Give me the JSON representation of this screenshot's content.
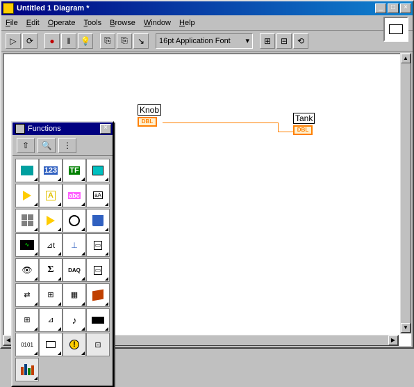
{
  "window": {
    "title": "Untitled 1 Diagram *",
    "minimize": "_",
    "maximize": "□",
    "close": "×"
  },
  "menu": {
    "file": "File",
    "edit": "Edit",
    "operate": "Operate",
    "tools": "Tools",
    "browse": "Browse",
    "window": "Window",
    "help": "Help"
  },
  "toolbar": {
    "run": "▷",
    "run_cont": "⟳",
    "abort": "●",
    "pause": "‖",
    "hilite": "💡",
    "retain": "⎘",
    "step": "⎘",
    "step_into": "↘",
    "font_label": "16pt Application Font",
    "align": "⊞",
    "dist": "⊟",
    "reorder": "⟲"
  },
  "palette": {
    "title": "Functions",
    "close": "×",
    "up": "⇧",
    "search": "🔍",
    "options": "⋮"
  },
  "diagram": {
    "knob": {
      "label": "Knob",
      "type": "DBL"
    },
    "tank": {
      "label": "Tank",
      "type": "DBL"
    }
  },
  "pal_items": {
    "struct": "▭",
    "num": "123",
    "bool": "TF",
    "arr": "",
    "tri": "▷",
    "str_a": "A",
    "str": "abc",
    "strbox": "aA",
    "clust": "",
    "comp": "",
    "timer": "",
    "disk": "",
    "wave": "∿",
    "axes": "⊿t",
    "stat": "⊥",
    "dev": "▭",
    "eye": "👁",
    "sigma": "Σ",
    "daq": "DAQ",
    "instr": "▭",
    "net": "⇄",
    "conn": "⊞",
    "vi": "▦",
    "cube": "",
    "app": "⊞",
    "math": "⊿",
    "note": "♪",
    "hat": "",
    "bin": "0101",
    "print": "",
    "warn": "!",
    "view": "⊡",
    "books": ""
  }
}
